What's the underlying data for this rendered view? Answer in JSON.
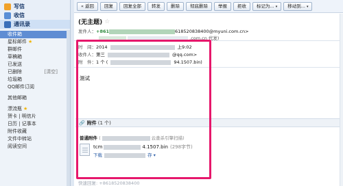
{
  "sidebar": {
    "write": "写信",
    "inbox_top": "收信",
    "contacts": "通讯录",
    "folders": [
      {
        "label": "收件箱",
        "selected": true
      },
      {
        "label": "星标邮件",
        "star": true
      },
      {
        "label": "群邮件"
      },
      {
        "label": "草稿箱"
      },
      {
        "label": "已发送"
      },
      {
        "label": "已删除",
        "extra": "[清空]"
      },
      {
        "label": "垃圾箱"
      },
      {
        "label": "QQ邮件订阅"
      },
      {
        "label": "其他邮箱",
        "sep": true
      },
      {
        "label": "漂流瓶",
        "sep": true,
        "star": true
      },
      {
        "label": "贺卡 | 明信片"
      },
      {
        "label": "日历 | 记事本"
      },
      {
        "label": "附件收藏"
      },
      {
        "label": "文件中转站"
      },
      {
        "label": "阅读空间"
      }
    ]
  },
  "toolbar": {
    "buttons": [
      {
        "label": "« 返回"
      },
      {
        "label": "回复"
      },
      {
        "label": "回复全部"
      },
      {
        "label": "转发"
      },
      {
        "label": "删除"
      },
      {
        "label": "彻底删除"
      },
      {
        "label": "举报"
      },
      {
        "label": "拒收"
      },
      {
        "label": "标记为...",
        "dropdown": true
      },
      {
        "label": "移动到...",
        "dropdown": true
      }
    ]
  },
  "mail": {
    "subject": "(无主题)",
    "sender_label": "发件人：",
    "sender_prefix": "+861",
    "sender_addr": "618520838400@myuni.com.cn>",
    "sender_line2": ".com.cn 代发)",
    "time_label": "时　间：",
    "time_value": "2014",
    "time_end": "上9:02",
    "to_label": "收件人：",
    "to_value": "第三",
    "to_end": "@qq.com>",
    "att_label": "附　件：",
    "att_value": "1 个 (",
    "att_end": "94.1507.bin)",
    "body": "测试"
  },
  "attachments": {
    "header": "附件",
    "count": "(1 个)",
    "type_label": "普通附件",
    "type_note_start": "(",
    "type_note_end": "云查杀引擎扫描)",
    "file_name_prefix": "tcm",
    "file_name_suffix": "4.1507.bin",
    "file_size": "(298字节)",
    "action_prefix": "下载",
    "action_suffix": "存",
    "action_caret": "▾"
  },
  "footer": {
    "reply_hint": "快速回复: +8618520838400"
  },
  "colors": {
    "highlight": "#e6176b",
    "selected_folder": "#5f8dd3"
  },
  "icons": {
    "write": "pencil-icon",
    "inbox": "envelope-icon",
    "contacts": "address-book-icon"
  }
}
